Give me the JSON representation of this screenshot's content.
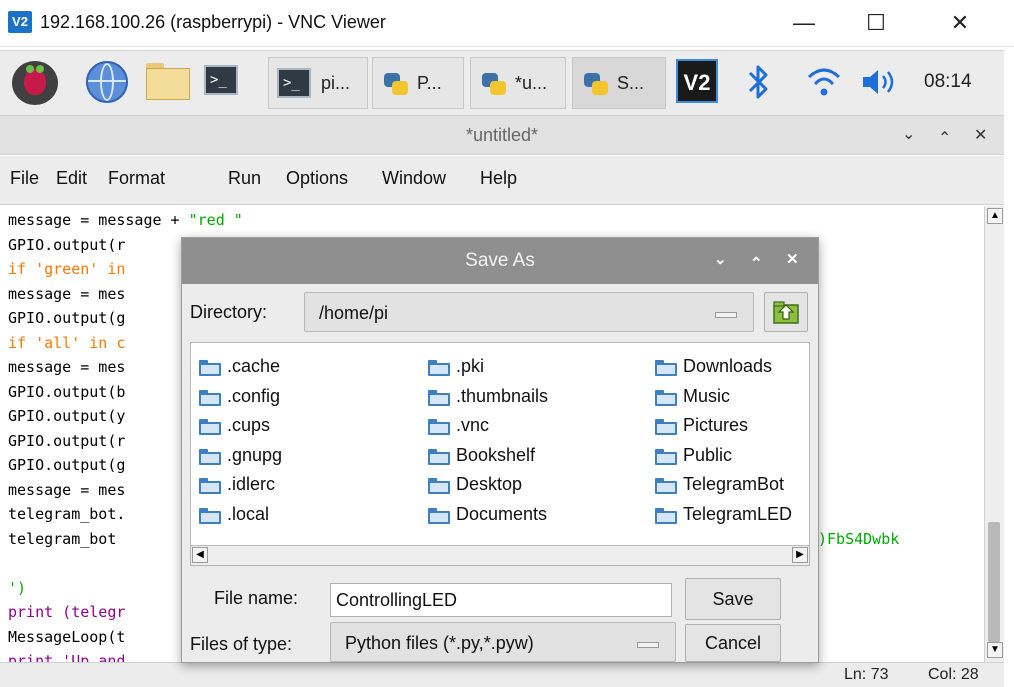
{
  "vnc_window": {
    "logo": "V2",
    "title": "192.168.100.26 (raspberrypi) - VNC Viewer",
    "minimize": "—",
    "maximize": "☐",
    "close": "✕"
  },
  "panel": {
    "tasks": [
      {
        "icon": "terminal-icon",
        "label": "pi..."
      },
      {
        "icon": "python-icon",
        "label": "P..."
      },
      {
        "icon": "python-icon",
        "label": "*u..."
      },
      {
        "icon": "python-icon",
        "label": "S..."
      }
    ],
    "tray_vnc": "V2",
    "time": "08:14"
  },
  "idle_window": {
    "title": "*untitled*",
    "controls": [
      "⌄",
      "⌃",
      "✕"
    ],
    "menu": [
      "File",
      "Edit",
      "Format",
      "Run",
      "Options",
      "Window",
      "Help"
    ]
  },
  "editor": {
    "lines_top": [
      [
        "message = message + ",
        "\"red \""
      ],
      [
        "GPIO.output(r",
        ""
      ],
      [
        "if 'green' in",
        ""
      ],
      [
        "message = mes",
        ""
      ],
      [
        "GPIO.output(g",
        ""
      ],
      [
        "if 'all' in c",
        ""
      ],
      [
        "message = mes",
        ""
      ],
      [
        "GPIO.output(b",
        ""
      ],
      [
        "GPIO.output(y",
        ""
      ],
      [
        "GPIO.output(r",
        ""
      ],
      [
        "GPIO.output(g",
        ""
      ],
      [
        "message = mes",
        ""
      ],
      [
        "telegram_bot.",
        ""
      ],
      [
        "telegram_bot ",
        ""
      ]
    ],
    "token_fragment": ")FbS4Dwbk",
    "lines_bottom": [
      "')",
      "print (telegr",
      "MessageLoop(t",
      "print 'Up and"
    ],
    "status": {
      "line": "Ln: 73",
      "col": "Col: 28"
    }
  },
  "dialog": {
    "title": "Save As",
    "directory_label": "Directory:",
    "directory_value": "/home/pi",
    "columns": [
      [
        ".cache",
        ".config",
        ".cups",
        ".gnupg",
        ".idlerc",
        ".local"
      ],
      [
        ".pki",
        ".thumbnails",
        ".vnc",
        "Bookshelf",
        "Desktop",
        "Documents"
      ],
      [
        "Downloads",
        "Music",
        "Pictures",
        "Public",
        "TelegramBot",
        "TelegramLED"
      ]
    ],
    "filename_label": "File name:",
    "filename_value": "ControllingLED",
    "filetype_label": "Files of type:",
    "filetype_value": "Python files (*.py,*.pyw)",
    "save": "Save",
    "cancel": "Cancel"
  },
  "colors": {
    "keyword": "#ff7700",
    "string": "#00aa00",
    "builtin": "#900090",
    "dialog_title_bg": "#8f8f8f",
    "folder_blue": "#3d7fc1",
    "vnc_blue": "#1a73c9"
  }
}
